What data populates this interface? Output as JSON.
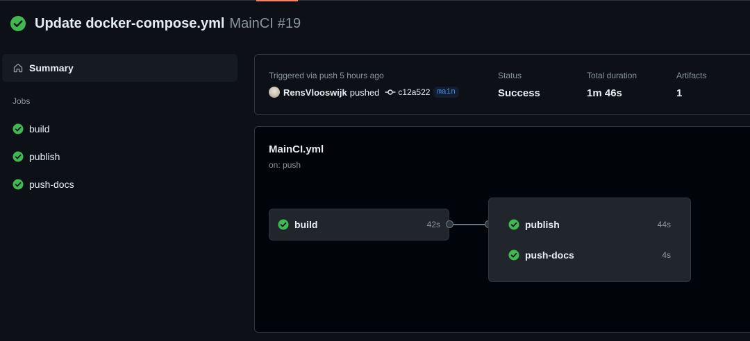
{
  "header": {
    "title": "Update docker-compose.yml",
    "workflow": "MainCI",
    "run_number": "#19"
  },
  "sidebar": {
    "summary_label": "Summary",
    "jobs_heading": "Jobs",
    "jobs": [
      {
        "label": "build",
        "status": "success"
      },
      {
        "label": "publish",
        "status": "success"
      },
      {
        "label": "push-docs",
        "status": "success"
      }
    ]
  },
  "summary": {
    "trigger_text": "Triggered via push 5 hours ago",
    "user": "RensVlooswijk",
    "action": "pushed",
    "commit": "c12a522",
    "branch": "main",
    "status_label": "Status",
    "status_value": "Success",
    "duration_label": "Total duration",
    "duration_value": "1m 46s",
    "artifacts_label": "Artifacts",
    "artifacts_value": "1"
  },
  "graph": {
    "file": "MainCI.yml",
    "trigger": "on: push",
    "build": {
      "name": "build",
      "duration": "42s"
    },
    "group": [
      {
        "name": "publish",
        "duration": "44s"
      },
      {
        "name": "push-docs",
        "duration": "4s"
      }
    ]
  },
  "colors": {
    "success": "#3fb950",
    "background": "#0d1117",
    "card": "#161b22",
    "node": "#21262d",
    "border": "#30363d",
    "accent": "#f78166",
    "link": "#4493f8"
  },
  "icons": {
    "status": "check-circle-fill-icon",
    "summary": "home-icon",
    "commit": "git-commit-icon"
  }
}
